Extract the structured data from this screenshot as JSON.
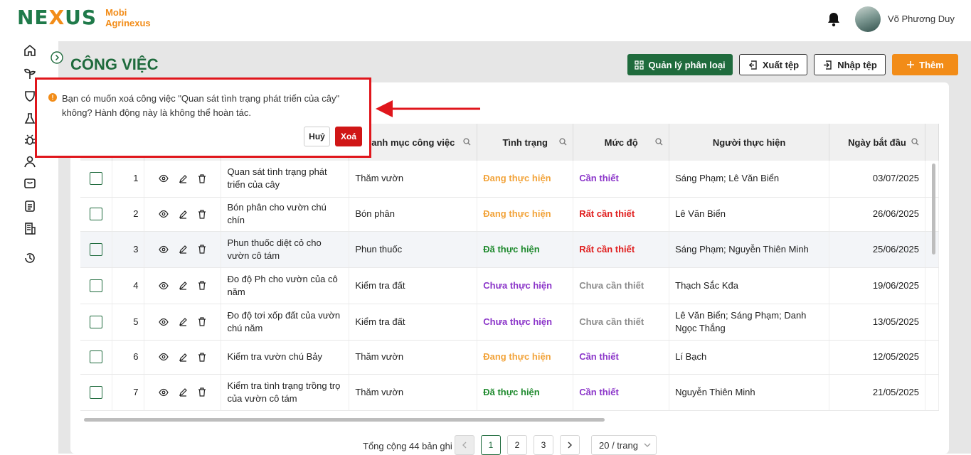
{
  "brand": {
    "logo_left": "NE",
    "logo_x": "X",
    "logo_right": "US",
    "line1": "Mobi",
    "line2": "Agrinexus"
  },
  "user": {
    "name": "Võ Phương Duy"
  },
  "page": {
    "title": "CÔNG VIỆC"
  },
  "toolbar": {
    "categories": "Quản lý phân loại",
    "export": "Xuất tệp",
    "import": "Nhập tệp",
    "add": "Thêm"
  },
  "columns": {
    "category": "anh mục công việc",
    "status": "Tình trạng",
    "level": "Mức độ",
    "assignee": "Người thực hiện",
    "start": "Ngày bắt đầu"
  },
  "rows": [
    {
      "no": "1",
      "name": "Quan sát tình trạng phát triển của cây",
      "category": "Thăm vườn",
      "status": "Đang thực hiện",
      "status_type": "doing",
      "level": "Cần thiết",
      "level_type": "need",
      "assignee": "Sáng Phạm; Lê  Văn Biển",
      "date": "03/07/2025"
    },
    {
      "no": "2",
      "name": "Bón phân cho vườn chú chín",
      "category": "Bón phân",
      "status": "Đang thực hiện",
      "status_type": "doing",
      "level": "Rất cần thiết",
      "level_type": "very",
      "assignee": "Lê  Văn Biển",
      "date": "26/06/2025"
    },
    {
      "no": "3",
      "name": "Phun thuốc diệt cỏ cho vườn cô tám",
      "category": "Phun thuốc",
      "status": "Đã thực hiện",
      "status_type": "done",
      "level": "Rất cần thiết",
      "level_type": "very",
      "assignee": "Sáng Phạm; Nguyễn  Thiên Minh",
      "date": "25/06/2025"
    },
    {
      "no": "4",
      "name": "Đo độ Ph cho vườn của cô năm",
      "category": "Kiểm tra đất",
      "status": "Chưa thực hiện",
      "status_type": "not",
      "level": "Chưa cần thiết",
      "level_type": "no",
      "assignee": "Thạch Sắc Kđa",
      "date": "19/06/2025"
    },
    {
      "no": "5",
      "name": "Đo độ tơi xốp đất của vườn chú năm",
      "category": "Kiểm tra đất",
      "status": "Chưa thực hiện",
      "status_type": "not",
      "level": "Chưa cần thiết",
      "level_type": "no",
      "assignee": "Lê  Văn Biển; Sáng Phạm; Danh  Ngọc Thắng",
      "date": "13/05/2025"
    },
    {
      "no": "6",
      "name": "Kiểm tra vườn chú Bảy",
      "category": "Thăm vườn",
      "status": "Đang thực hiện",
      "status_type": "doing",
      "level": "Cần thiết",
      "level_type": "need",
      "assignee": "Lí  Bạch",
      "date": "12/05/2025"
    },
    {
      "no": "7",
      "name": "Kiểm tra tình trạng trồng trọ của vườn cô tám",
      "category": "Thăm vườn",
      "status": "Đã thực hiện",
      "status_type": "done",
      "level": "Cần thiết",
      "level_type": "need",
      "assignee": "Nguyễn  Thiên Minh",
      "date": "21/05/2025"
    }
  ],
  "pagination": {
    "total": "Tổng cộng 44 bản ghi",
    "pages": [
      "1",
      "2",
      "3"
    ],
    "page_size": "20 / trang"
  },
  "confirm": {
    "message": "Bạn có muốn xoá công việc \"Quan sát tình trạng phát triển của cây\" không? Hành động này là không thể hoàn tác.",
    "cancel": "Huỷ",
    "ok": "Xoá"
  },
  "colors": {
    "primary": "#1f6b3d",
    "accent": "#f28c18",
    "danger": "#d01616"
  }
}
